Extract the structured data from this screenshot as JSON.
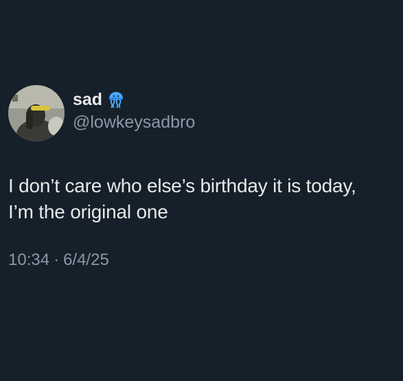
{
  "tweet": {
    "author": {
      "display_name": "sad",
      "handle": "@lowkeysadbro",
      "badge_icon": "jellyfish-emoji-icon",
      "avatar_icon": "profile-photo"
    },
    "text_line1": "I don’t care who else’s birthday it is today,",
    "text_line2": "I’m the original one",
    "time": "10:34",
    "separator": "·",
    "date": "6/4/25"
  },
  "colors": {
    "background": "#16202a",
    "text": "#e7e9ea",
    "secondary_text": "#8b98a5",
    "badge": "#4aa8ff"
  }
}
